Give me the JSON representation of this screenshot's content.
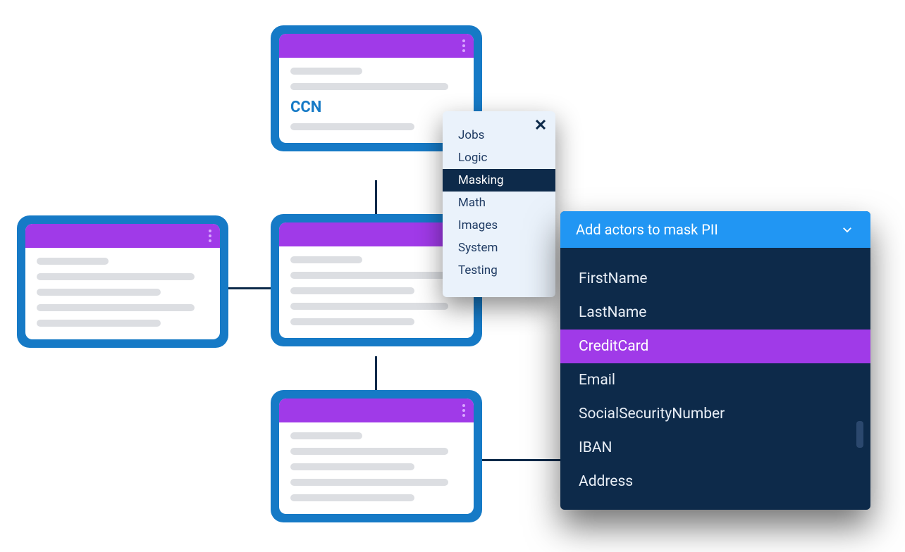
{
  "nodes": {
    "top": {
      "field_label": "CCN"
    }
  },
  "context_menu": {
    "items": [
      {
        "label": "Jobs",
        "selected": false
      },
      {
        "label": "Logic",
        "selected": false
      },
      {
        "label": "Masking",
        "selected": true
      },
      {
        "label": "Math",
        "selected": false
      },
      {
        "label": "Images",
        "selected": false
      },
      {
        "label": "System",
        "selected": false
      },
      {
        "label": "Testing",
        "selected": false
      }
    ]
  },
  "picker": {
    "header": "Add actors to mask PII",
    "items": [
      {
        "label": "FirstName",
        "selected": false
      },
      {
        "label": "LastName",
        "selected": false
      },
      {
        "label": "CreditCard",
        "selected": true
      },
      {
        "label": "Email",
        "selected": false
      },
      {
        "label": "SocialSecurityNumber",
        "selected": false
      },
      {
        "label": "IBAN",
        "selected": false
      },
      {
        "label": "Address",
        "selected": false
      }
    ]
  }
}
